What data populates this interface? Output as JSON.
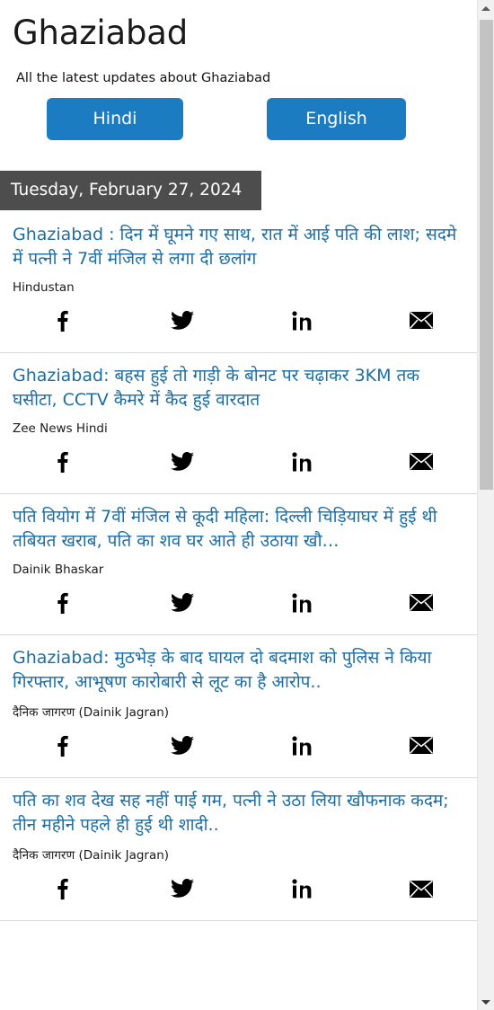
{
  "header": {
    "title": "Ghaziabad",
    "subtitle": "All the latest updates about Ghaziabad"
  },
  "language_buttons": {
    "hindi": "Hindi",
    "english": "English"
  },
  "date_bar": {
    "date": "Tuesday, February 27, 2024"
  },
  "share": {
    "facebook_label": "f",
    "twitter_label": "twitter-bird",
    "linkedin_label": "in",
    "email_label": "envelope"
  },
  "colors": {
    "button_blue": "#1b7cc2",
    "headline_blue": "#1c6da3",
    "date_bar_gray": "#4d4d4d",
    "separator": "#d9d9d9",
    "scrollbar_track": "#f1f1f1",
    "scrollbar_thumb": "#c3c3c3"
  },
  "news": [
    {
      "headline": "Ghaziabad : दिन में घूमने गए साथ, रात में आई पति की लाश; सदमे में पत्नी ने 7वीं मंजिल से लगा दी छलांग",
      "source": "Hindustan"
    },
    {
      "headline": "Ghaziabad: बहस हुई तो गाड़ी के बोनट पर चढ़ाकर 3KM तक घसीटा, CCTV कैमरे में कैद हुई वारदात",
      "source": "Zee News Hindi"
    },
    {
      "headline": "पति वियोग में 7वीं मंजिल से कूदी महिला: दिल्ली चिड़ियाघर में हुई थी तबियत खराब, पति का शव घर आते ही उठाया खौ…",
      "source": "Dainik Bhaskar"
    },
    {
      "headline": "Ghaziabad: मुठभेड़ के बाद घायल दो बदमाश को पुलिस ने किया गिरफ्तार, आभूषण कारोबारी से लूट का है आरोप..",
      "source": "दैनिक जागरण (Dainik Jagran)"
    },
    {
      "headline": "पति का शव देख सह नहीं पाई गम, पत्नी ने उठा लिया खौफनाक कदम; तीन महीने पहले ही हुई थी शादी..",
      "source": "दैनिक जागरण (Dainik Jagran)"
    }
  ]
}
